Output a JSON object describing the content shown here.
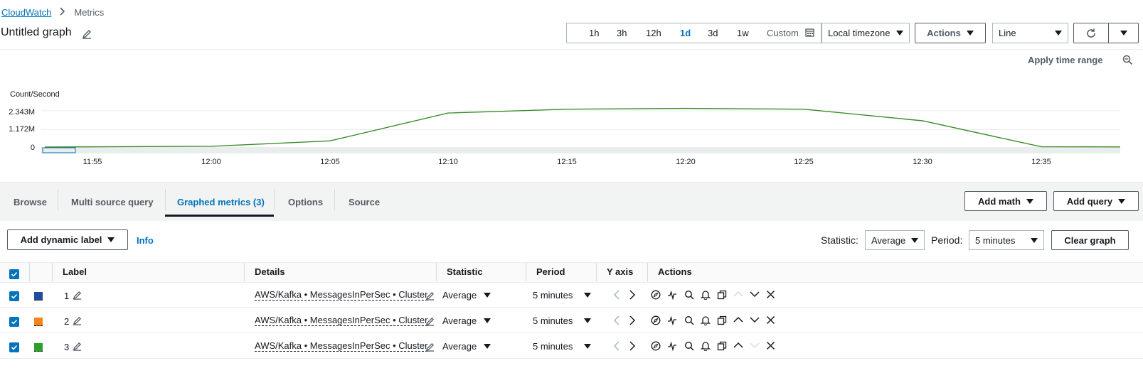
{
  "breadcrumb": {
    "root": "CloudWatch",
    "current": "Metrics"
  },
  "title": "Untitled graph",
  "time_ranges": [
    "1h",
    "3h",
    "12h",
    "1d",
    "3d",
    "1w"
  ],
  "active_range": "1d",
  "custom_label": "Custom",
  "timezone": "Local timezone",
  "actions_label": "Actions",
  "graph_type": "Line",
  "apply_time_range": "Apply time range",
  "chart": {
    "ylabel": "Count/Second",
    "yticks": [
      "2.343M",
      "1.172M",
      "0"
    ],
    "xticks": [
      "11:55",
      "12:00",
      "12:05",
      "12:10",
      "12:15",
      "12:20",
      "12:25",
      "12:30",
      "12:35"
    ]
  },
  "chart_data": {
    "type": "line",
    "ylabel": "Count/Second",
    "ylim": [
      0,
      2.343
    ],
    "x": [
      "11:55",
      "12:00",
      "12:05",
      "12:10",
      "12:15",
      "12:20",
      "12:25",
      "12:30",
      "12:35",
      "12:38"
    ],
    "series": [
      {
        "color": "#2ca02c",
        "values": [
          0.05,
          0.4,
          2.2,
          2.45,
          2.5,
          2.45,
          1.7,
          0.02,
          0.01,
          0.0
        ]
      }
    ]
  },
  "tabs": [
    "Browse",
    "Multi source query",
    "Graphed metrics (3)",
    "Options",
    "Source"
  ],
  "active_tab": "Graphed metrics (3)",
  "add_math": "Add math",
  "add_query": "Add query",
  "add_dynamic_label": "Add dynamic label",
  "info": "Info",
  "statistic_label": "Statistic:",
  "statistic_value": "Average",
  "period_label": "Period:",
  "period_value": "5 minutes",
  "clear_graph": "Clear graph",
  "table": {
    "headers": [
      "Label",
      "Details",
      "Statistic",
      "Period",
      "Y axis",
      "Actions"
    ],
    "rows": [
      {
        "label": "1",
        "color": "#1f4e9c",
        "details": "AWS/Kafka • MessagesInPerSec • Cluster",
        "statistic": "Average",
        "period": "5 minutes"
      },
      {
        "label": "2",
        "color": "#f58518",
        "details": "AWS/Kafka • MessagesInPerSec • Cluster",
        "statistic": "Average",
        "period": "5 minutes"
      },
      {
        "label": "3",
        "color": "#2ca02c",
        "details": "AWS/Kafka • MessagesInPerSec • Cluster",
        "statistic": "Average",
        "period": "5 minutes"
      }
    ]
  }
}
